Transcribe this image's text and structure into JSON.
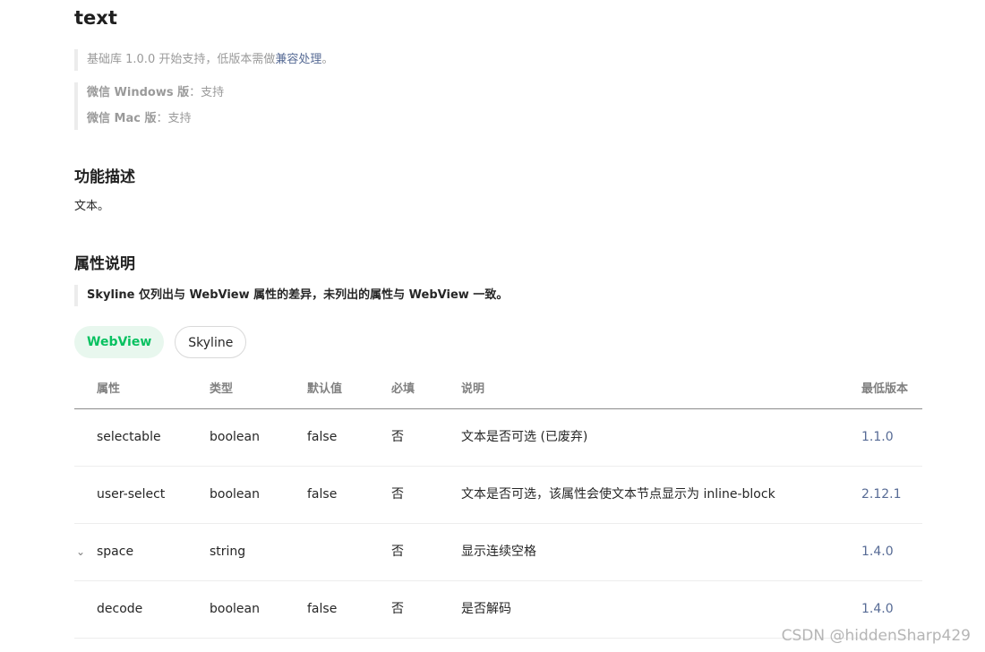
{
  "page": {
    "title": "text"
  },
  "support_note": {
    "prefix": "基础库 1.0.0 开始支持，低版本需做",
    "link": "兼容处理",
    "suffix": "。"
  },
  "platform_notes": [
    {
      "platform": "微信 Windows 版",
      "sep": "：",
      "value": "支持"
    },
    {
      "platform": "微信 Mac 版",
      "sep": "：",
      "value": "支持"
    }
  ],
  "feature_section": {
    "heading": "功能描述",
    "text": "文本。"
  },
  "attr_section": {
    "heading": "属性说明",
    "note": "Skyline 仅列出与 WebView 属性的差异，未列出的属性与 WebView 一致。"
  },
  "tabs": [
    {
      "label": "WebView",
      "active": true
    },
    {
      "label": "Skyline",
      "active": false
    }
  ],
  "table": {
    "headers": [
      "属性",
      "类型",
      "默认值",
      "必填",
      "说明",
      "最低版本"
    ],
    "rows": [
      {
        "name": "selectable",
        "type": "boolean",
        "default": "false",
        "required": "否",
        "desc": "文本是否可选 (已废弃)",
        "version": "1.1.0",
        "expandable": false
      },
      {
        "name": "user-select",
        "type": "boolean",
        "default": "false",
        "required": "否",
        "desc": "文本是否可选，该属性会使文本节点显示为 inline-block",
        "version": "2.12.1",
        "expandable": false
      },
      {
        "name": "space",
        "type": "string",
        "default": "",
        "required": "否",
        "desc": "显示连续空格",
        "version": "1.4.0",
        "expandable": true
      },
      {
        "name": "decode",
        "type": "boolean",
        "default": "false",
        "required": "否",
        "desc": "是否解码",
        "version": "1.4.0",
        "expandable": false
      }
    ]
  },
  "icons": {
    "expand": "chevron-down-icon",
    "expand_glyph": "⌄"
  },
  "watermark": "CSDN @hiddenSharp429",
  "colors": {
    "accent": "#07c160",
    "link": "#576b95",
    "muted": "#9a9a9a"
  }
}
